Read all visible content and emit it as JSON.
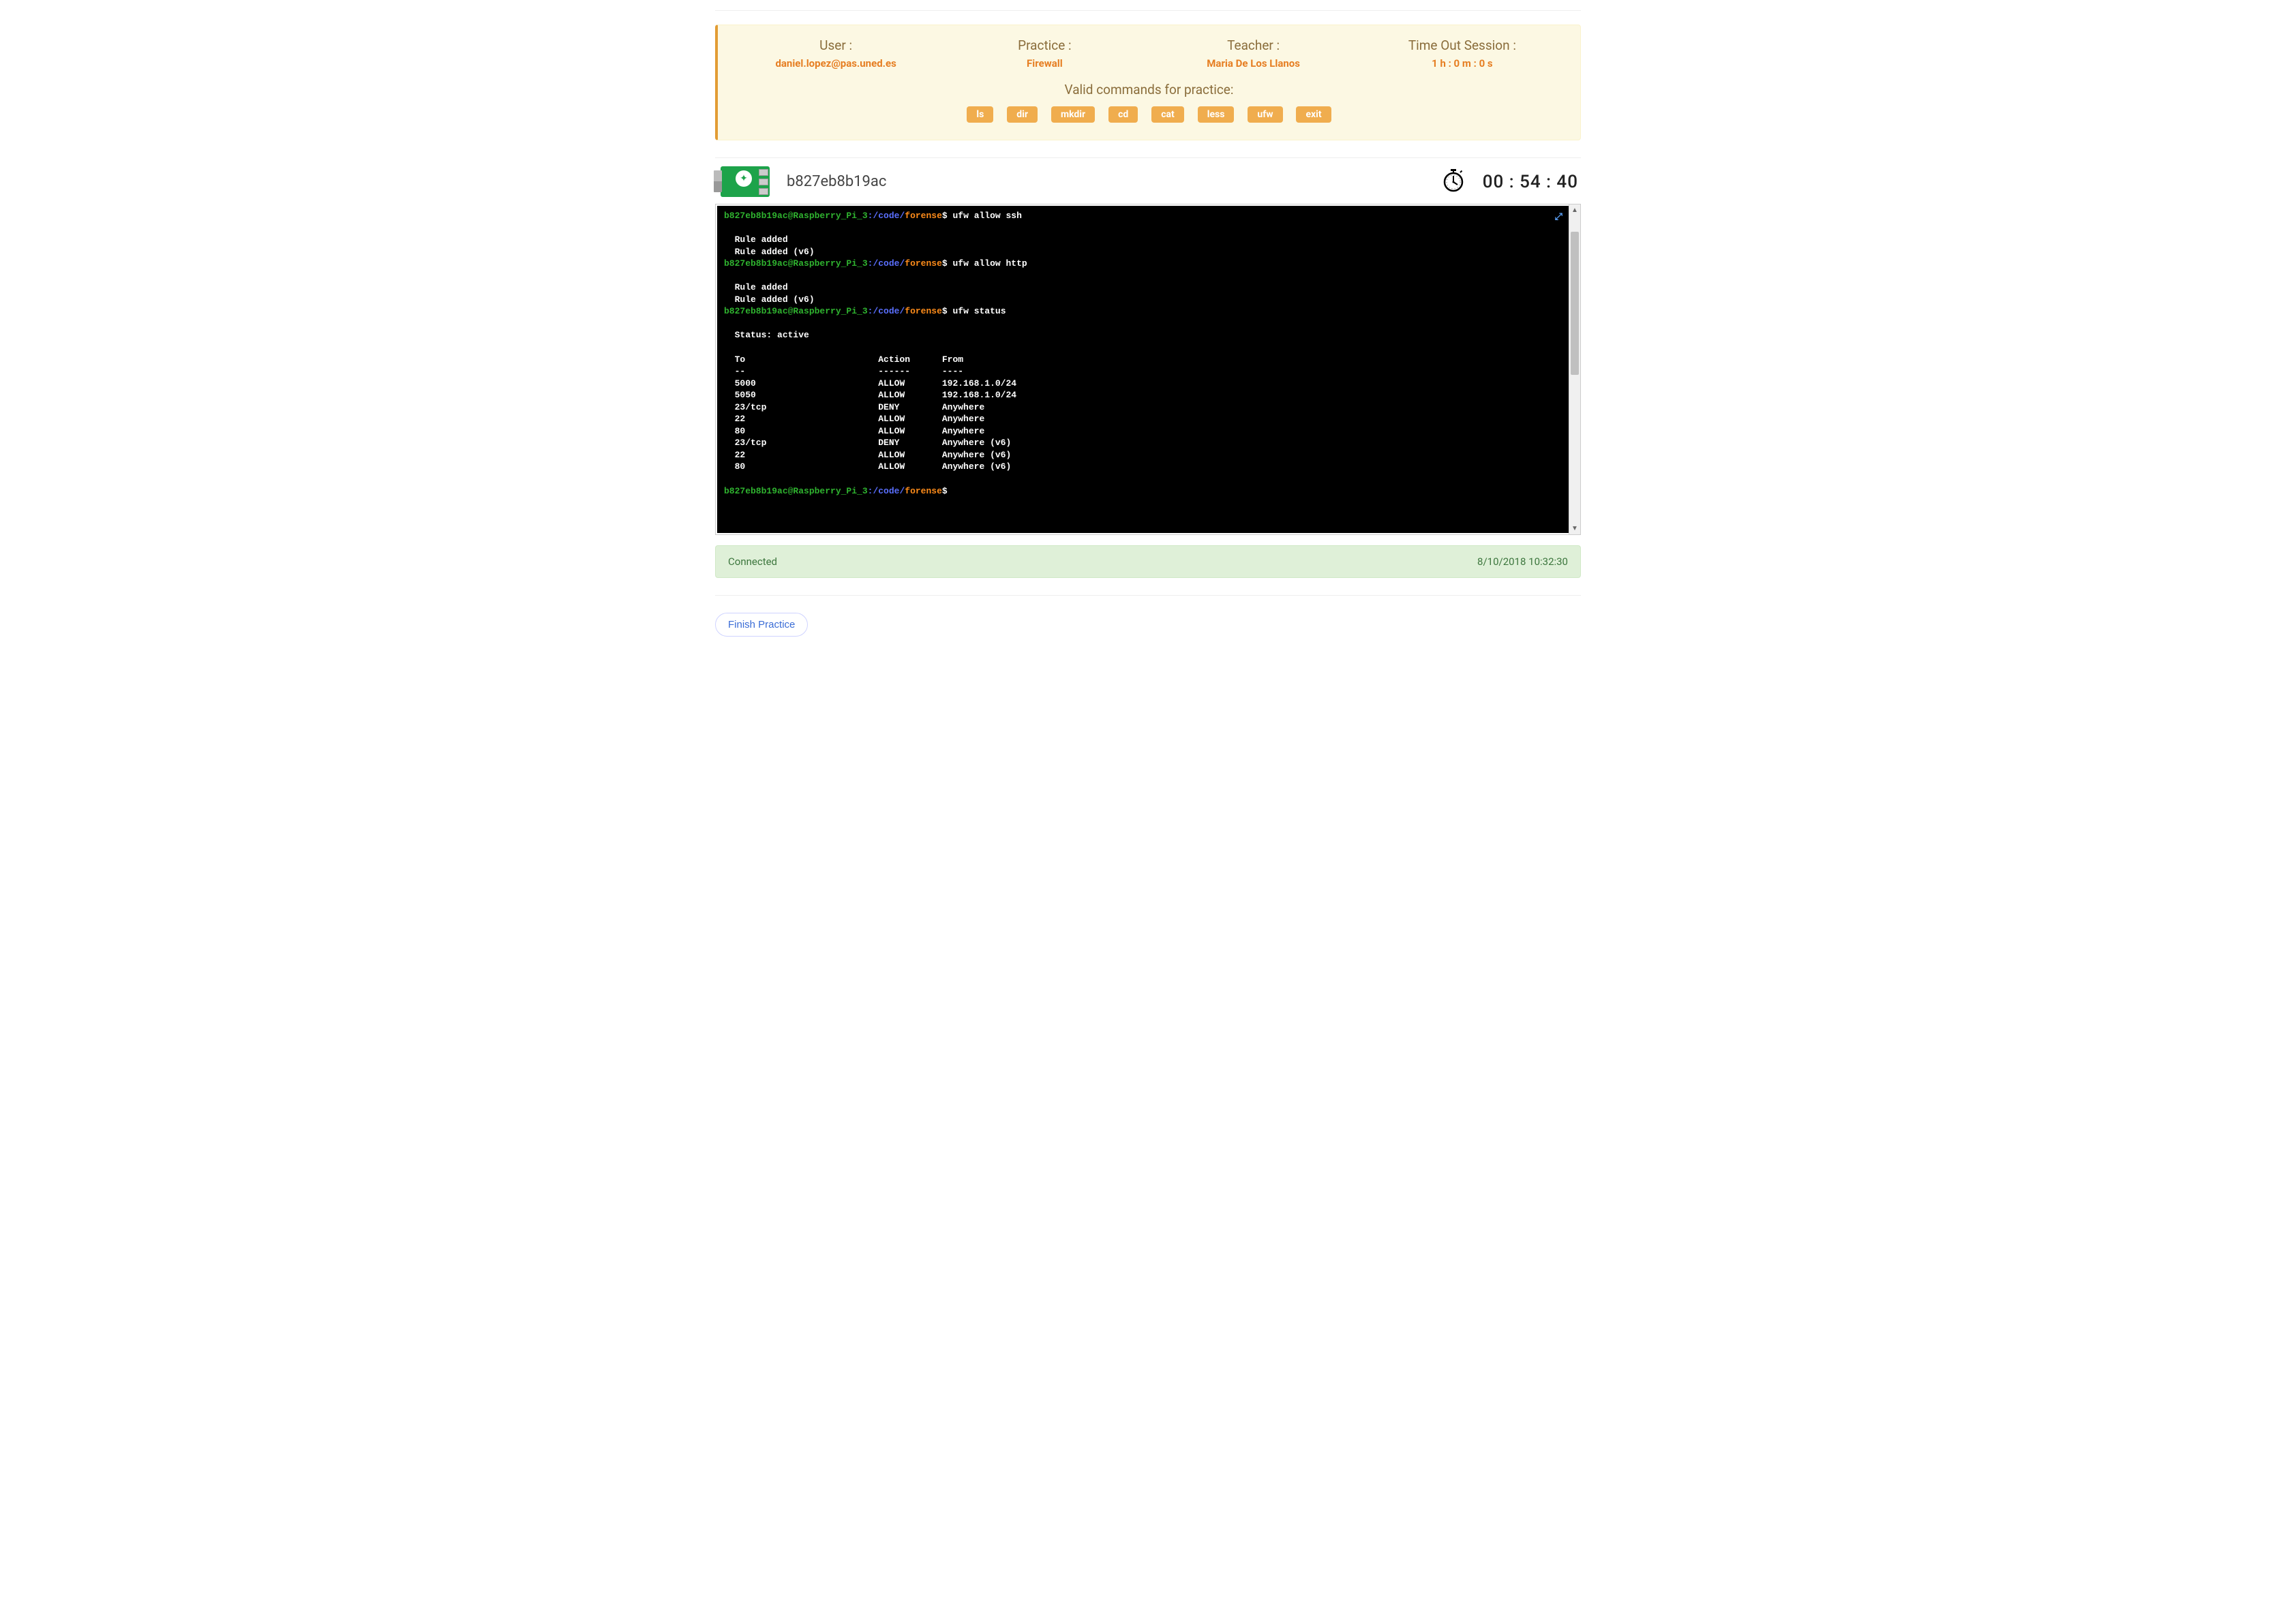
{
  "header": {
    "user_label": "User :",
    "user_value": "daniel.lopez@pas.uned.es",
    "practice_label": "Practice :",
    "practice_value": "Firewall",
    "teacher_label": "Teacher :",
    "teacher_value": "Maria De Los Llanos",
    "timeout_label": "Time Out Session :",
    "timeout_value": "1 h : 0 m : 0 s",
    "commands_title": "Valid commands for practice:",
    "commands": [
      "ls",
      "dir",
      "mkdir",
      "cd",
      "cat",
      "less",
      "ufw",
      "exit"
    ]
  },
  "device": {
    "id": "b827eb8b19ac",
    "timer": "00 : 54 : 40"
  },
  "terminal": {
    "prompt_user": "b827eb8b19ac@Raspberry_Pi_3",
    "prompt_colon": ":",
    "prompt_path1": "/code/",
    "prompt_path2": "forense",
    "prompt_dollar": "$",
    "block1_cmd": " ufw allow ssh",
    "block1_out": "\n\n  Rule added\n  Rule added (v6)",
    "block2_cmd": " ufw allow http",
    "block2_out": "\n\n  Rule added\n  Rule added (v6)",
    "block3_cmd": " ufw status",
    "status_header": "\n\n  Status: active\n",
    "status_cols": "  To                         Action      From",
    "status_sep": "  --                         ------      ----",
    "status_rows": [
      "  5000                       ALLOW       192.168.1.0/24",
      "  5050                       ALLOW       192.168.1.0/24",
      "  23/tcp                     DENY        Anywhere",
      "  22                         ALLOW       Anywhere",
      "  80                         ALLOW       Anywhere",
      "  23/tcp                     DENY        Anywhere (v6)",
      "  22                         ALLOW       Anywhere (v6)",
      "  80                         ALLOW       Anywhere (v6)"
    ]
  },
  "status": {
    "text": "Connected",
    "timestamp": "8/10/2018 10:32:30"
  },
  "footer": {
    "finish": "Finish Practice"
  }
}
